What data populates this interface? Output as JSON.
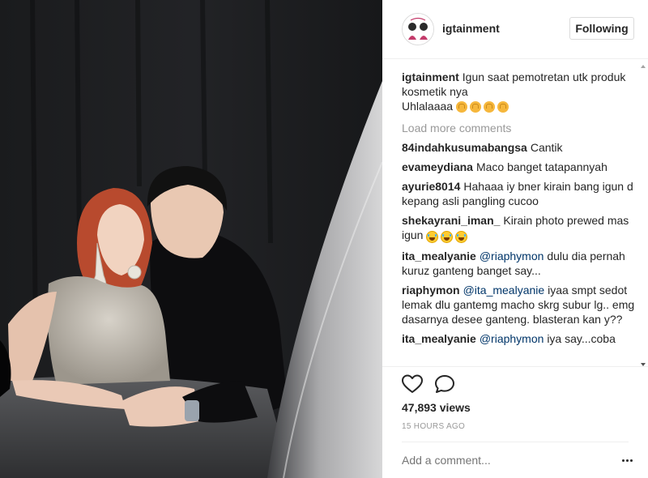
{
  "post": {
    "username": "igtainment",
    "follow_label": "Following",
    "caption_user": "igtainment",
    "caption_text": "Igun saat pemotretan utk produk kosmetik nya",
    "caption_line2": "Uhlalaaaa",
    "load_more": "Load more comments",
    "comments": [
      {
        "user": "84indahkusumabangsa",
        "text": "Cantik"
      },
      {
        "user": "evameydiana",
        "text": "Maco banget tatapannyah"
      },
      {
        "user": "ayurie8014",
        "text": "Hahaaa iy bner kirain bang igun d kepang asli pangling cucoo"
      },
      {
        "user": "shekayrani_iman_",
        "text": "Kirain photo prewed mas igun"
      },
      {
        "user": "ita_mealyanie",
        "mention": "@riaphymon",
        "text": "dulu dia pernah kuruz ganteng banget say..."
      },
      {
        "user": "riaphymon",
        "mention": "@ita_mealyanie",
        "text": "iyaa smpt sedot lemak dlu gantemg macho skrg subur lg.. emg dasarnya desee ganteng. blasteran kan y??"
      },
      {
        "user": "ita_mealyanie",
        "mention": "@riaphymon",
        "text": "iya say...coba"
      }
    ],
    "views": "47,893 views",
    "time": "15 HOURS AGO",
    "add_comment_placeholder": "Add a comment...",
    "icons": [
      "heart-icon",
      "comment-icon",
      "more-options-icon",
      "clapping-hands-emoji",
      "tears-of-joy-emoji"
    ],
    "colors": {
      "text": "#262626",
      "muted": "#999999",
      "mention": "#003569",
      "border": "#efefef"
    }
  }
}
